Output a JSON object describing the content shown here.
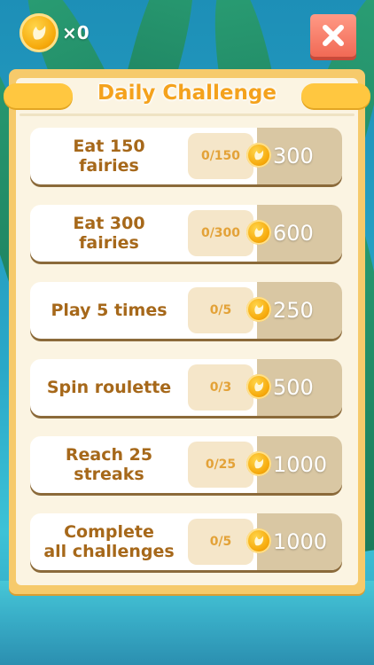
{
  "header": {
    "coin_count": "×0"
  },
  "panel": {
    "title": "Daily Challenge"
  },
  "challenges": [
    {
      "line1": "Eat 150",
      "line2": "fairies",
      "progress": "0/150",
      "reward": "300"
    },
    {
      "line1": "Eat 300",
      "line2": "fairies",
      "progress": "0/300",
      "reward": "600"
    },
    {
      "line1": "Play 5 times",
      "line2": "",
      "progress": "0/5",
      "reward": "250"
    },
    {
      "line1": "Spin roulette",
      "line2": "",
      "progress": "0/3",
      "reward": "500"
    },
    {
      "line1": "Reach 25",
      "line2": "streaks",
      "progress": "0/25",
      "reward": "1000"
    },
    {
      "line1": "Complete",
      "line2": "all challenges",
      "progress": "0/5",
      "reward": "1000"
    }
  ],
  "colors": {
    "panel_border": "#f6ca6b",
    "title": "#f4a21d",
    "label": "#a6681a",
    "close_button": "#f16a55"
  },
  "icons": {
    "coin": "gold-coin-icon",
    "close": "close-icon"
  }
}
